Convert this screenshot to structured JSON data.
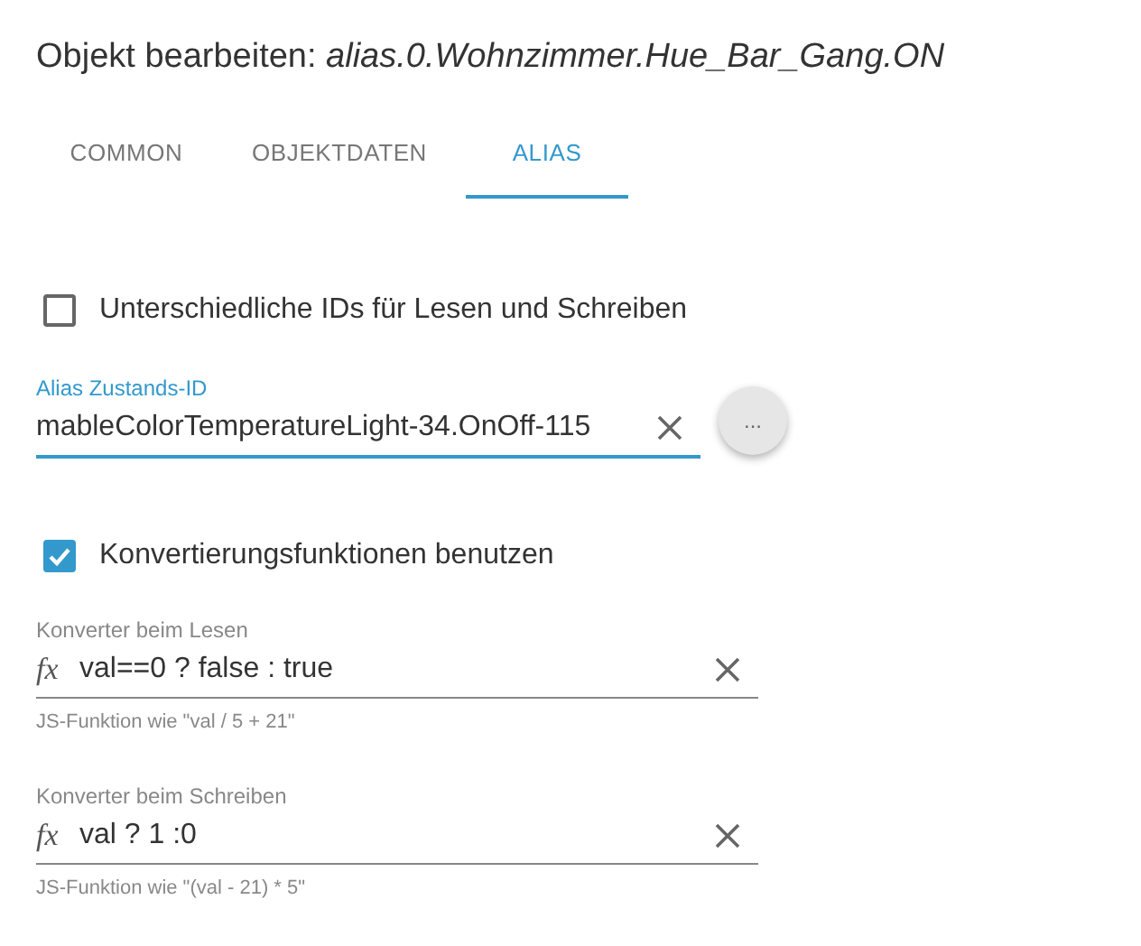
{
  "title": {
    "label": "Objekt bearbeiten: ",
    "object_id": "alias.0.Wohnzimmer.Hue_Bar_Gang.ON"
  },
  "tabs": [
    {
      "label": "COMMON",
      "selected": false
    },
    {
      "label": "OBJEKTDATEN",
      "selected": false
    },
    {
      "label": "ALIAS",
      "selected": true
    }
  ],
  "separate_ids": {
    "label": "Unterschiedliche IDs für Lesen und Schreiben",
    "checked": false
  },
  "alias_id": {
    "label": "Alias Zustands-ID",
    "value": "mableColorTemperatureLight-34.OnOff-115",
    "focused": true,
    "button": "..."
  },
  "use_converters": {
    "label": "Konvertierungsfunktionen benutzen",
    "checked": true
  },
  "converters": [
    {
      "label": "Konverter beim Lesen",
      "prefix": "fx",
      "value": "val==0 ? false : true",
      "helper": "JS-Funktion wie \"val / 5 + 21\""
    },
    {
      "label": "Konverter beim Schreiben",
      "prefix": "fx",
      "value": "val ? 1 :0",
      "helper": "JS-Funktion wie \"(val - 21) * 5\""
    }
  ]
}
